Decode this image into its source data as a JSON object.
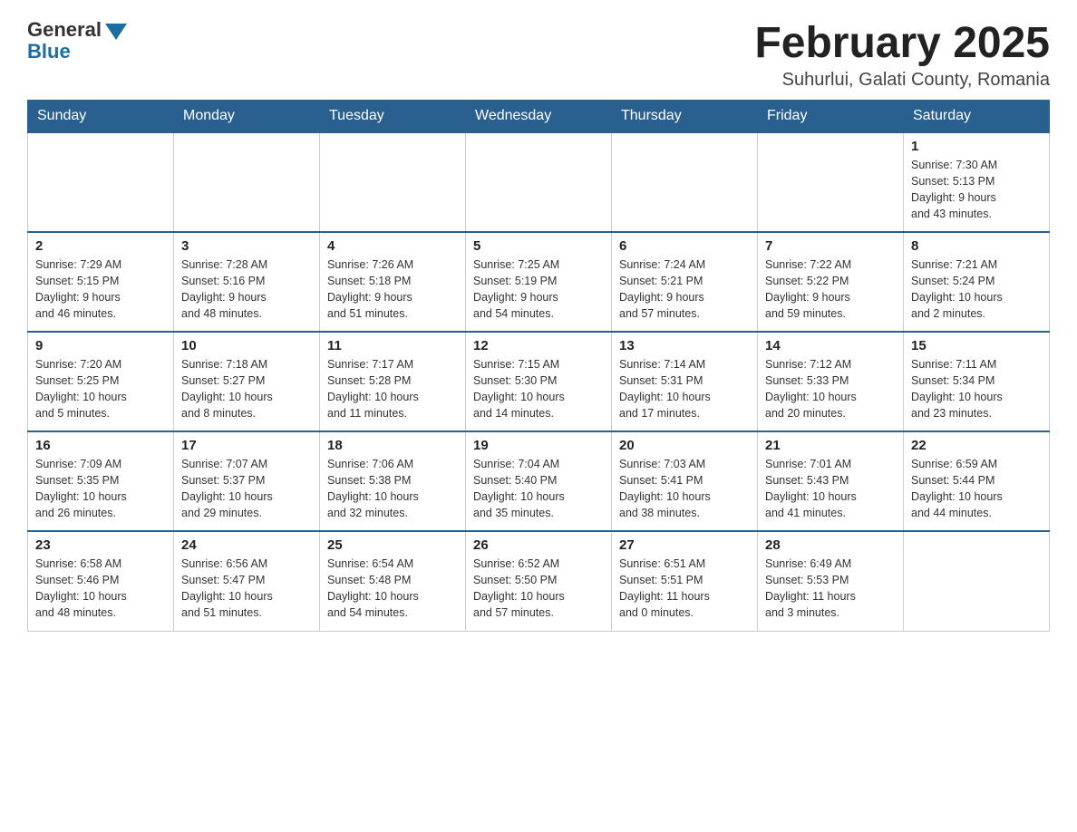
{
  "header": {
    "logo_general": "General",
    "logo_blue": "Blue",
    "month_year": "February 2025",
    "location": "Suhurlui, Galati County, Romania"
  },
  "weekdays": [
    "Sunday",
    "Monday",
    "Tuesday",
    "Wednesday",
    "Thursday",
    "Friday",
    "Saturday"
  ],
  "weeks": [
    [
      {
        "day": "",
        "info": ""
      },
      {
        "day": "",
        "info": ""
      },
      {
        "day": "",
        "info": ""
      },
      {
        "day": "",
        "info": ""
      },
      {
        "day": "",
        "info": ""
      },
      {
        "day": "",
        "info": ""
      },
      {
        "day": "1",
        "info": "Sunrise: 7:30 AM\nSunset: 5:13 PM\nDaylight: 9 hours\nand 43 minutes."
      }
    ],
    [
      {
        "day": "2",
        "info": "Sunrise: 7:29 AM\nSunset: 5:15 PM\nDaylight: 9 hours\nand 46 minutes."
      },
      {
        "day": "3",
        "info": "Sunrise: 7:28 AM\nSunset: 5:16 PM\nDaylight: 9 hours\nand 48 minutes."
      },
      {
        "day": "4",
        "info": "Sunrise: 7:26 AM\nSunset: 5:18 PM\nDaylight: 9 hours\nand 51 minutes."
      },
      {
        "day": "5",
        "info": "Sunrise: 7:25 AM\nSunset: 5:19 PM\nDaylight: 9 hours\nand 54 minutes."
      },
      {
        "day": "6",
        "info": "Sunrise: 7:24 AM\nSunset: 5:21 PM\nDaylight: 9 hours\nand 57 minutes."
      },
      {
        "day": "7",
        "info": "Sunrise: 7:22 AM\nSunset: 5:22 PM\nDaylight: 9 hours\nand 59 minutes."
      },
      {
        "day": "8",
        "info": "Sunrise: 7:21 AM\nSunset: 5:24 PM\nDaylight: 10 hours\nand 2 minutes."
      }
    ],
    [
      {
        "day": "9",
        "info": "Sunrise: 7:20 AM\nSunset: 5:25 PM\nDaylight: 10 hours\nand 5 minutes."
      },
      {
        "day": "10",
        "info": "Sunrise: 7:18 AM\nSunset: 5:27 PM\nDaylight: 10 hours\nand 8 minutes."
      },
      {
        "day": "11",
        "info": "Sunrise: 7:17 AM\nSunset: 5:28 PM\nDaylight: 10 hours\nand 11 minutes."
      },
      {
        "day": "12",
        "info": "Sunrise: 7:15 AM\nSunset: 5:30 PM\nDaylight: 10 hours\nand 14 minutes."
      },
      {
        "day": "13",
        "info": "Sunrise: 7:14 AM\nSunset: 5:31 PM\nDaylight: 10 hours\nand 17 minutes."
      },
      {
        "day": "14",
        "info": "Sunrise: 7:12 AM\nSunset: 5:33 PM\nDaylight: 10 hours\nand 20 minutes."
      },
      {
        "day": "15",
        "info": "Sunrise: 7:11 AM\nSunset: 5:34 PM\nDaylight: 10 hours\nand 23 minutes."
      }
    ],
    [
      {
        "day": "16",
        "info": "Sunrise: 7:09 AM\nSunset: 5:35 PM\nDaylight: 10 hours\nand 26 minutes."
      },
      {
        "day": "17",
        "info": "Sunrise: 7:07 AM\nSunset: 5:37 PM\nDaylight: 10 hours\nand 29 minutes."
      },
      {
        "day": "18",
        "info": "Sunrise: 7:06 AM\nSunset: 5:38 PM\nDaylight: 10 hours\nand 32 minutes."
      },
      {
        "day": "19",
        "info": "Sunrise: 7:04 AM\nSunset: 5:40 PM\nDaylight: 10 hours\nand 35 minutes."
      },
      {
        "day": "20",
        "info": "Sunrise: 7:03 AM\nSunset: 5:41 PM\nDaylight: 10 hours\nand 38 minutes."
      },
      {
        "day": "21",
        "info": "Sunrise: 7:01 AM\nSunset: 5:43 PM\nDaylight: 10 hours\nand 41 minutes."
      },
      {
        "day": "22",
        "info": "Sunrise: 6:59 AM\nSunset: 5:44 PM\nDaylight: 10 hours\nand 44 minutes."
      }
    ],
    [
      {
        "day": "23",
        "info": "Sunrise: 6:58 AM\nSunset: 5:46 PM\nDaylight: 10 hours\nand 48 minutes."
      },
      {
        "day": "24",
        "info": "Sunrise: 6:56 AM\nSunset: 5:47 PM\nDaylight: 10 hours\nand 51 minutes."
      },
      {
        "day": "25",
        "info": "Sunrise: 6:54 AM\nSunset: 5:48 PM\nDaylight: 10 hours\nand 54 minutes."
      },
      {
        "day": "26",
        "info": "Sunrise: 6:52 AM\nSunset: 5:50 PM\nDaylight: 10 hours\nand 57 minutes."
      },
      {
        "day": "27",
        "info": "Sunrise: 6:51 AM\nSunset: 5:51 PM\nDaylight: 11 hours\nand 0 minutes."
      },
      {
        "day": "28",
        "info": "Sunrise: 6:49 AM\nSunset: 5:53 PM\nDaylight: 11 hours\nand 3 minutes."
      },
      {
        "day": "",
        "info": ""
      }
    ]
  ]
}
